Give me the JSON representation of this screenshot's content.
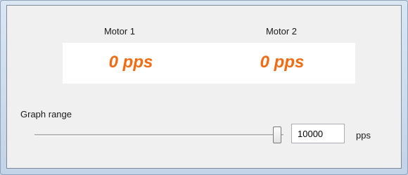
{
  "motors": [
    {
      "label": "Motor 1",
      "speed": "0 pps"
    },
    {
      "label": "Motor 2",
      "speed": "0 pps"
    }
  ],
  "graph_range": {
    "label": "Graph range",
    "value": "10000",
    "unit": "pps",
    "slider_level": 1.0
  },
  "colors": {
    "speed_text": "#f26b12",
    "panel_background": "#f0f0f0"
  }
}
